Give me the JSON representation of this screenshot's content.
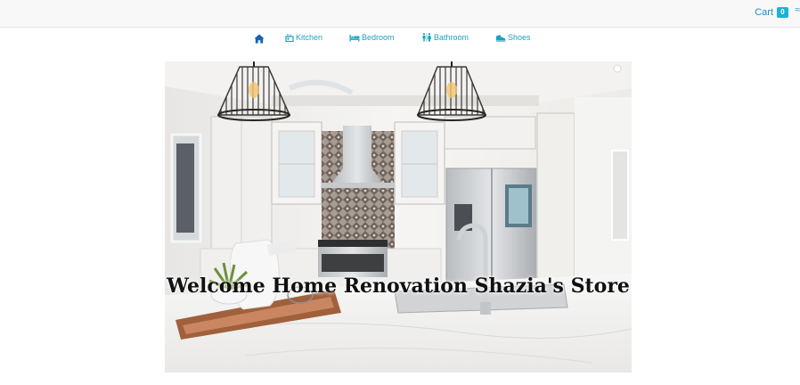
{
  "header": {
    "cart_label": "Cart",
    "cart_count": "0",
    "edge_mark": "≈"
  },
  "nav": {
    "items": [
      {
        "label": "",
        "icon": "home-icon"
      },
      {
        "label": "Kitchen",
        "icon": "kitchen-icon"
      },
      {
        "label": "Bedroom",
        "icon": "bed-icon"
      },
      {
        "label": "Bathroom",
        "icon": "restroom-icon"
      },
      {
        "label": "Shoes",
        "icon": "shoe-icon"
      }
    ]
  },
  "hero": {
    "title": "Welcome Home Renovation Shazia's Store",
    "image": "kitchen-interior-photo"
  },
  "colors": {
    "link": "#1a8ec9",
    "nav_link": "#1fa2c1",
    "badge": "#17b4d8",
    "topbar_bg": "#f8f8f8"
  }
}
